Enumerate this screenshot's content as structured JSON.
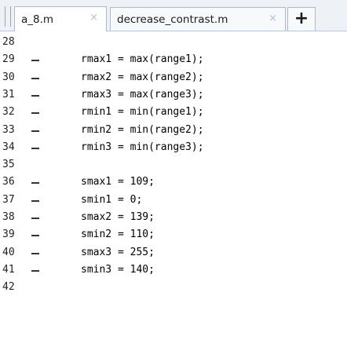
{
  "tabs": [
    {
      "label": "a_8.m",
      "close": "×",
      "active": true
    },
    {
      "label": "decrease_contrast.m",
      "close": "×",
      "active": false
    }
  ],
  "add_tab_label": "+",
  "lines": [
    {
      "num": "28",
      "code": "",
      "breakpoint_dash": false
    },
    {
      "num": "29",
      "code": "rmax1 = max(range1);",
      "breakpoint_dash": true
    },
    {
      "num": "30",
      "code": "rmax2 = max(range2);",
      "breakpoint_dash": true
    },
    {
      "num": "31",
      "code": "rmax3 = max(range3);",
      "breakpoint_dash": true
    },
    {
      "num": "32",
      "code": "rmin1 = min(range1);",
      "breakpoint_dash": true
    },
    {
      "num": "33",
      "code": "rmin2 = min(range2);",
      "breakpoint_dash": true
    },
    {
      "num": "34",
      "code": "rmin3 = min(range3);",
      "breakpoint_dash": true
    },
    {
      "num": "35",
      "code": "",
      "breakpoint_dash": false
    },
    {
      "num": "36",
      "code": "smax1 = 109;",
      "breakpoint_dash": true
    },
    {
      "num": "37",
      "code": "smin1 = 0;",
      "breakpoint_dash": true
    },
    {
      "num": "38",
      "code": "smax2 = 139;",
      "breakpoint_dash": true
    },
    {
      "num": "39",
      "code": "smin2 = 110;",
      "breakpoint_dash": true
    },
    {
      "num": "40",
      "code": "smax3 = 255;",
      "breakpoint_dash": true
    },
    {
      "num": "41",
      "code": "smin3 = 140;",
      "breakpoint_dash": true
    },
    {
      "num": "42",
      "code": "",
      "breakpoint_dash": false
    }
  ]
}
